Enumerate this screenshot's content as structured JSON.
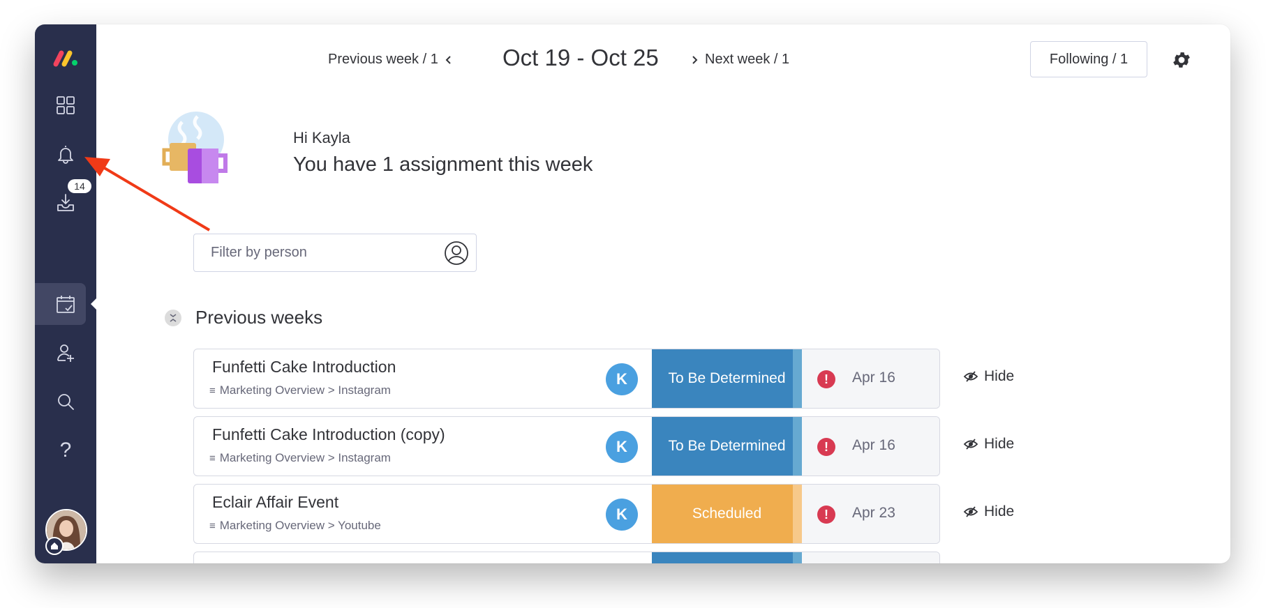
{
  "sidebar": {
    "logo": "monday-logo",
    "items": [
      {
        "name": "workspaces",
        "icon": "grid-icon"
      },
      {
        "name": "notifications",
        "icon": "bell-icon"
      },
      {
        "name": "inbox",
        "icon": "inbox-download-icon",
        "badge": "14"
      },
      {
        "name": "my-work",
        "icon": "calendar-check-icon",
        "active": true
      },
      {
        "name": "invite-members",
        "icon": "user-plus-icon"
      },
      {
        "name": "search",
        "icon": "search-icon"
      },
      {
        "name": "help",
        "icon": "question-icon",
        "glyph": "?"
      }
    ],
    "user_avatar": "Kayla profile photo"
  },
  "week_nav": {
    "previous_label": "Previous week / 1",
    "date_range": "Oct 19 - Oct 25",
    "next_label": "Next week / 1"
  },
  "header": {
    "following_label": "Following / 1",
    "settings_icon": "gear-icon"
  },
  "greeting": {
    "name_line": "Hi Kayla",
    "message": "You have 1 assignment this week"
  },
  "filter": {
    "placeholder": "Filter by person",
    "value": ""
  },
  "section": {
    "title": "Previous weeks"
  },
  "colors": {
    "sidebar_bg": "#292f4c",
    "status_tbd": "#3a85be",
    "status_tbd_tail": "#66a9d1",
    "status_scheduled": "#f0ad4e",
    "status_scheduled_tail": "#f7c98a",
    "alert": "#d83a52",
    "avatar": "#4aa0e0",
    "annotation_arrow": "#f03a17"
  },
  "rows": [
    {
      "title": "Funfetti Cake Introduction",
      "path": "Marketing Overview > Instagram",
      "assignee": "K",
      "status": "To Be Determined",
      "status_color": "#3a85be",
      "tail_color": "#66a9d1",
      "date": "Apr 16",
      "overdue": true,
      "hide_label": "Hide"
    },
    {
      "title": "Funfetti Cake Introduction (copy)",
      "path": "Marketing Overview > Instagram",
      "assignee": "K",
      "status": "To Be Determined",
      "status_color": "#3a85be",
      "tail_color": "#66a9d1",
      "date": "Apr 16",
      "overdue": true,
      "hide_label": "Hide"
    },
    {
      "title": "Eclair Affair Event",
      "path": "Marketing Overview > Youtube",
      "assignee": "K",
      "status": "Scheduled",
      "status_color": "#f0ad4e",
      "tail_color": "#f7c98a",
      "date": "Apr 23",
      "overdue": true,
      "hide_label": "Hide"
    },
    {
      "title": "",
      "path": "",
      "assignee": "",
      "status": "",
      "status_color": "#3a85be",
      "tail_color": "#66a9d1",
      "date": "",
      "overdue": false,
      "hide_label": ""
    }
  ]
}
